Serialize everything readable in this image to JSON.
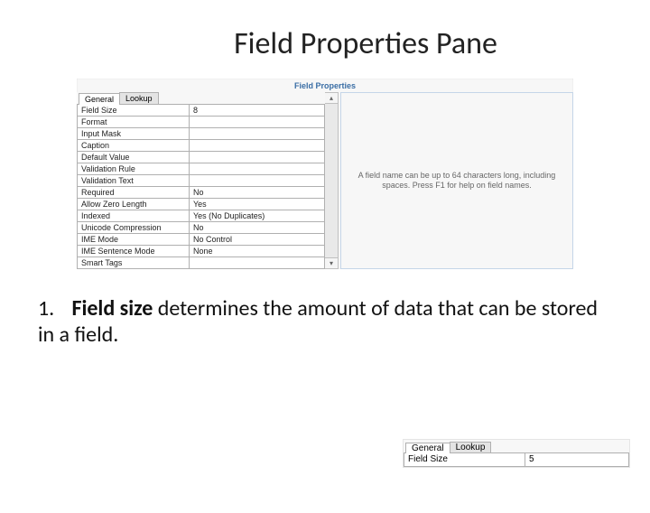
{
  "title": "Field Properties Pane",
  "pane": {
    "header": "Field Properties",
    "tabs": {
      "general": "General",
      "lookup": "Lookup"
    },
    "rows": [
      {
        "label": "Field Size",
        "value": "8"
      },
      {
        "label": "Format",
        "value": ""
      },
      {
        "label": "Input Mask",
        "value": ""
      },
      {
        "label": "Caption",
        "value": ""
      },
      {
        "label": "Default Value",
        "value": ""
      },
      {
        "label": "Validation Rule",
        "value": ""
      },
      {
        "label": "Validation Text",
        "value": ""
      },
      {
        "label": "Required",
        "value": "No"
      },
      {
        "label": "Allow Zero Length",
        "value": "Yes"
      },
      {
        "label": "Indexed",
        "value": "Yes (No Duplicates)"
      },
      {
        "label": "Unicode Compression",
        "value": "No"
      },
      {
        "label": "IME Mode",
        "value": "No Control"
      },
      {
        "label": "IME Sentence Mode",
        "value": "None"
      },
      {
        "label": "Smart Tags",
        "value": ""
      }
    ],
    "hint": "A field name can be up to 64 characters long, including spaces. Press F1 for help on field names."
  },
  "bullet": {
    "num": "1.",
    "bold": "Field size",
    "rest": " determines the amount of data that can be stored in a field."
  },
  "mini": {
    "tabs": {
      "general": "General",
      "lookup": "Lookup"
    },
    "row": {
      "label": "Field Size",
      "value": "5"
    }
  }
}
